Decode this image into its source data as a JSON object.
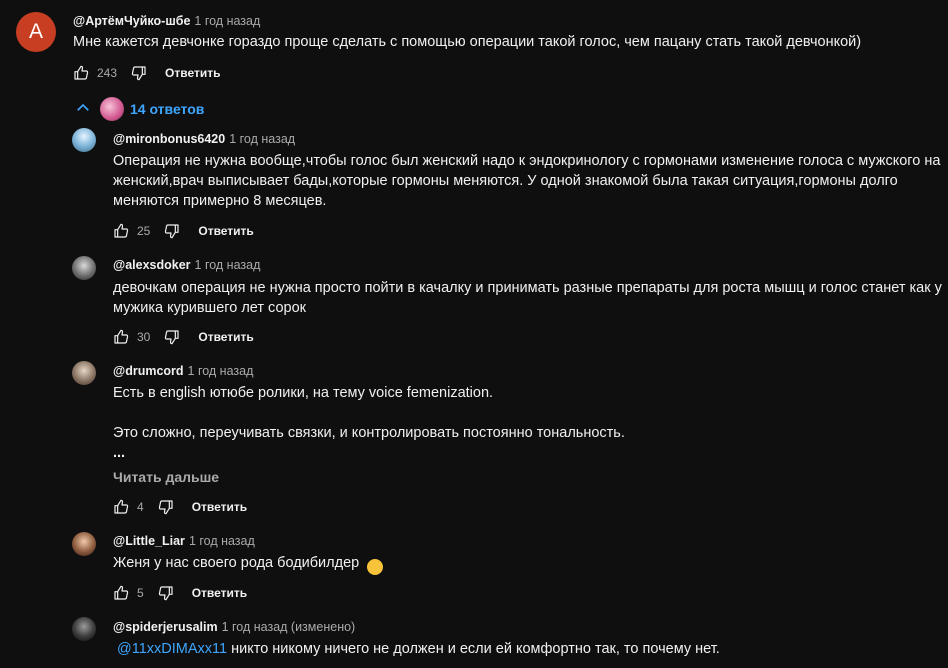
{
  "top_comment": {
    "avatar_letter": "A",
    "author": "@АртёмЧуйко-шбе",
    "time": "1 год назад",
    "text": "Мне кажется девчонке гораздо проще сделать с помощью операции такой голос, чем пацану стать такой девчонкой)",
    "likes": "243",
    "reply_label": "Ответить"
  },
  "replies_toggle": {
    "label": "14 ответов",
    "icon": "chevron-up-icon"
  },
  "replies": [
    {
      "author": "@mironbonus6420",
      "time": "1 год назад",
      "lines": [
        "Операция не нужна вообще,чтобы голос был женский надо к эндокринологу с гормонами изменение голоса с мужского на",
        "женский,врач выписывает бады,которые гормоны меняются. У одной знакомой была такая ситуация,гормоны долго",
        "меняются примерно 8 месяцев."
      ],
      "likes": "25",
      "reply_label": "Ответить"
    },
    {
      "author": "@alexsdoker",
      "time": "1 год назад",
      "lines": [
        "девочкам операция не нужна просто пойти в качалку и принимать разные препараты для роста мышц и голос станет как у",
        "мужика курившего лет сорок"
      ],
      "likes": "30",
      "reply_label": "Ответить"
    },
    {
      "author": "@drumcord",
      "time": "1 год назад",
      "lines": [
        "Есть в english ютюбе ролики, на тему voice femenization.",
        "",
        "Это сложно, переучивать связки, и контролировать постоянно тональность.",
        "..."
      ],
      "read_more": "Читать дальше",
      "likes": "4",
      "reply_label": "Ответить"
    },
    {
      "author": "@Little_Liar",
      "time": "1 год назад",
      "text": "Женя у нас своего рода бодибилдер",
      "emoji": "😀",
      "likes": "5",
      "reply_label": "Ответить"
    },
    {
      "author": "@spiderjerusalim",
      "time": "1 год назад (изменено)",
      "mention": "@11xxDIMAxx11",
      "text": " никто никому ничего не должен и если ей комфортно так, то почему нет."
    }
  ],
  "colors": {
    "background": "#0f0f0f",
    "text": "#f1f1f1",
    "secondary": "#aaaaaa",
    "link": "#3ea6ff",
    "letter_avatar": "#c73e23"
  }
}
